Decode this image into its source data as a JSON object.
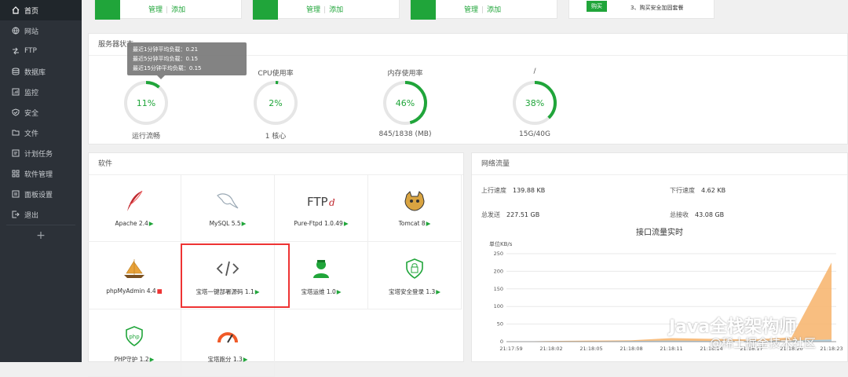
{
  "sidebar": {
    "items": [
      {
        "label": "首页",
        "icon": "home-icon",
        "active": true
      },
      {
        "label": "网站",
        "icon": "globe-icon"
      },
      {
        "label": "FTP",
        "icon": "ftp-icon"
      },
      {
        "label": "数据库",
        "icon": "database-icon"
      },
      {
        "label": "监控",
        "icon": "monitor-icon"
      },
      {
        "label": "安全",
        "icon": "shield-icon"
      },
      {
        "label": "文件",
        "icon": "folder-icon"
      },
      {
        "label": "计划任务",
        "icon": "clock-icon"
      },
      {
        "label": "软件管理",
        "icon": "grid-icon"
      },
      {
        "label": "面板设置",
        "icon": "settings-icon"
      },
      {
        "label": "退出",
        "icon": "logout-icon"
      }
    ],
    "add_label": "+"
  },
  "top_cards": [
    {
      "manage": "管理",
      "add": "添加",
      "divider": "|"
    },
    {
      "manage": "管理",
      "add": "添加",
      "divider": "|"
    },
    {
      "manage": "管理",
      "add": "添加",
      "divider": "|"
    },
    {
      "buy": "购买",
      "note": "3、购买安全加固套餐"
    }
  ],
  "status": {
    "title": "服务器状态",
    "tooltip": [
      "最近1分钟平均负载：0.21",
      "最近5分钟平均负载：0.15",
      "最近15分钟平均负载：0.15"
    ],
    "gauges": [
      {
        "label": "",
        "value": "11%",
        "percent": 11,
        "sub": "运行流畅"
      },
      {
        "label": "CPU使用率",
        "value": "2%",
        "percent": 2,
        "sub": "1 核心"
      },
      {
        "label": "内存使用率",
        "value": "46%",
        "percent": 46,
        "sub": "845/1838 (MB)"
      },
      {
        "label": "/",
        "value": "38%",
        "percent": 38,
        "sub": "15G/40G"
      }
    ],
    "accent": "#20a53a"
  },
  "software": {
    "title": "软件",
    "items": [
      {
        "name": "Apache 2.4",
        "icon": "apache-feather-icon",
        "status": "▶"
      },
      {
        "name": "MySQL 5.5",
        "icon": "mysql-dolphin-icon",
        "status": "▶"
      },
      {
        "name": "Pure-Ftpd 1.0.49",
        "icon": "ftpd-icon",
        "status": "▶"
      },
      {
        "name": "Tomcat 8",
        "icon": "tomcat-icon",
        "status": "▶"
      },
      {
        "name": "phpMyAdmin 4.4",
        "icon": "phpmyadmin-icon",
        "status": "■"
      },
      {
        "name": "宝塔一键部署源码 1.1",
        "icon": "code-icon",
        "status": "▶"
      },
      {
        "name": "宝塔运维 1.0",
        "icon": "ops-user-icon",
        "status": "▶"
      },
      {
        "name": "宝塔安全登录 1.3",
        "icon": "lock-shield-icon",
        "status": "▶"
      },
      {
        "name": "PHP守护 1.2",
        "icon": "php-shield-icon",
        "status": "▶"
      },
      {
        "name": "宝塔跑分 1.3",
        "icon": "speedometer-icon",
        "status": "▶"
      }
    ]
  },
  "network": {
    "title": "网络流量",
    "up_label": "上行速度",
    "up_value": "139.88 KB",
    "down_label": "下行速度",
    "down_value": "4.62 KB",
    "sent_label": "总发送",
    "sent_value": "227.51 GB",
    "recv_label": "总接收",
    "recv_value": "43.08 GB"
  },
  "chart_data": {
    "type": "area",
    "title": "接口流量实时",
    "ylabel": "单位KB/s",
    "ylim": [
      0,
      250
    ],
    "yticks": [
      0,
      50,
      100,
      150,
      200,
      250
    ],
    "x": [
      "21:17:59",
      "21:18:02",
      "21:18:05",
      "21:18:08",
      "21:18:11",
      "21:18:14",
      "21:18:17",
      "21:18:20",
      "21:18:23"
    ],
    "series": [
      {
        "color": "#f7b36a",
        "values": [
          0,
          2,
          3,
          4,
          10,
          8,
          6,
          12,
          225
        ]
      },
      {
        "color": "#a6d4f0",
        "values": [
          0,
          1,
          1,
          2,
          3,
          2,
          2,
          3,
          6
        ]
      }
    ]
  },
  "watermark": {
    "line1": "Java全栈架构师",
    "line2": "@稀土掘金技术社区"
  }
}
